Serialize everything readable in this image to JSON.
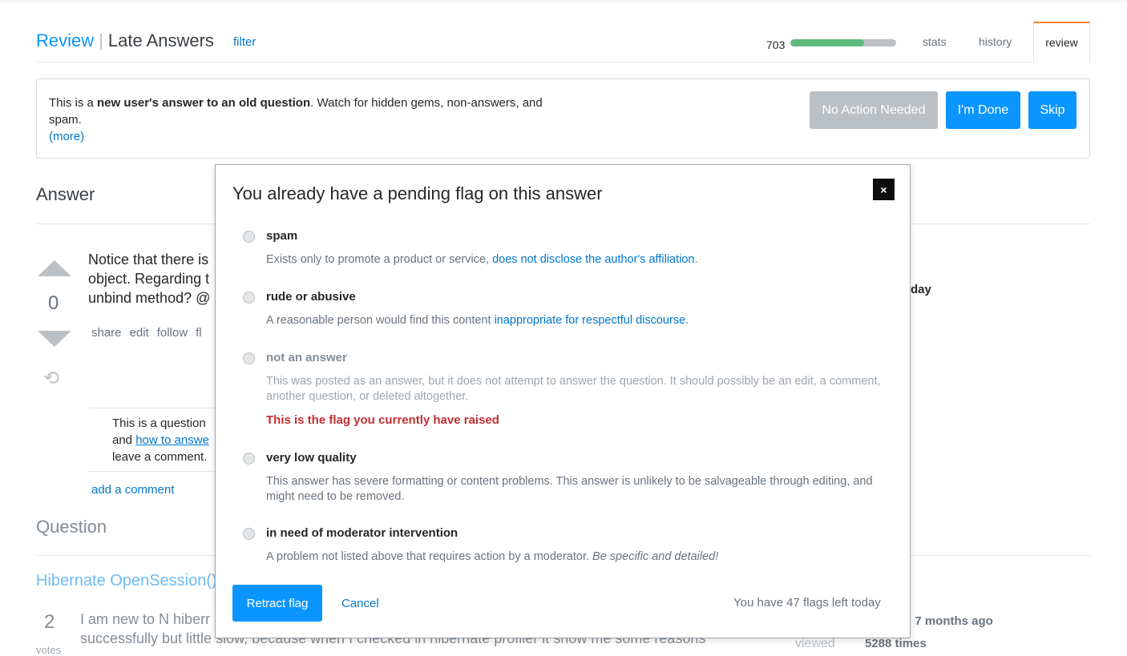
{
  "header": {
    "review": "Review",
    "separator": "|",
    "queue": "Late Answers",
    "filter": "filter",
    "count": "703",
    "progress_percent": 70,
    "tabs": [
      "stats",
      "history",
      "review"
    ],
    "active_tab": "review"
  },
  "info": {
    "prefix": "This is a ",
    "bold": "new user's answer to an old question",
    "suffix": ". Watch for hidden gems, non-answers, and spam.",
    "more": "(more)"
  },
  "actions": {
    "no_action": "No Action Needed",
    "done": "I'm Done",
    "skip": "Skip"
  },
  "answer": {
    "heading": "Answer",
    "lines": [
      "Notice that there is",
      "object. Regarding t",
      "unbind method? @"
    ],
    "votes": "0",
    "menu": [
      "share",
      "edit",
      "follow",
      "fl"
    ],
    "side_fragment": "day",
    "comment_lines": [
      "This is a question",
      "and ",
      "leave a comment."
    ],
    "comment_link": "how to answe",
    "add_comment": "add a comment"
  },
  "question": {
    "heading": "Question",
    "title": "Hibernate OpenSession()",
    "votes": "2",
    "votes_label": "votes",
    "lines": [
      "I am new to N hiberr",
      "successfully but little slow, because when I checked in hibernate profiler it show me some reasons"
    ],
    "asked": ", 7 months ago",
    "viewed_label": "viewed",
    "viewed": "5288 times"
  },
  "modal": {
    "title": "You already have a pending flag on this answer",
    "close": "×",
    "options": [
      {
        "label": "spam",
        "desc": "Exists only to promote a product or service, ",
        "link": "does not disclose the author's affiliation",
        "end": "."
      },
      {
        "label": "rude or abusive",
        "desc": "A reasonable person would find this content ",
        "link": "inappropriate for respectful discourse",
        "end": "."
      },
      {
        "label": "not an answer",
        "desc": "This was posted as an answer, but it does not attempt to answer the question. It should possibly be an edit, a comment, another question, or deleted altogether.",
        "raised": "This is the flag you currently have raised"
      },
      {
        "label": "very low quality",
        "desc": "This answer has severe formatting or content problems. This answer is unlikely to be salvageable through editing, and might need to be removed."
      },
      {
        "label": "in need of moderator intervention",
        "desc": "A problem not listed above that requires action by a moderator. ",
        "em": "Be specific and detailed!"
      }
    ],
    "retract": "Retract flag",
    "cancel": "Cancel",
    "flags_left": "You have 47 flags left today"
  },
  "colors": {
    "accent": "#0a95ff",
    "progress": "#5eba7d",
    "active_tab": "#f48024",
    "raised": "#c22e32"
  }
}
